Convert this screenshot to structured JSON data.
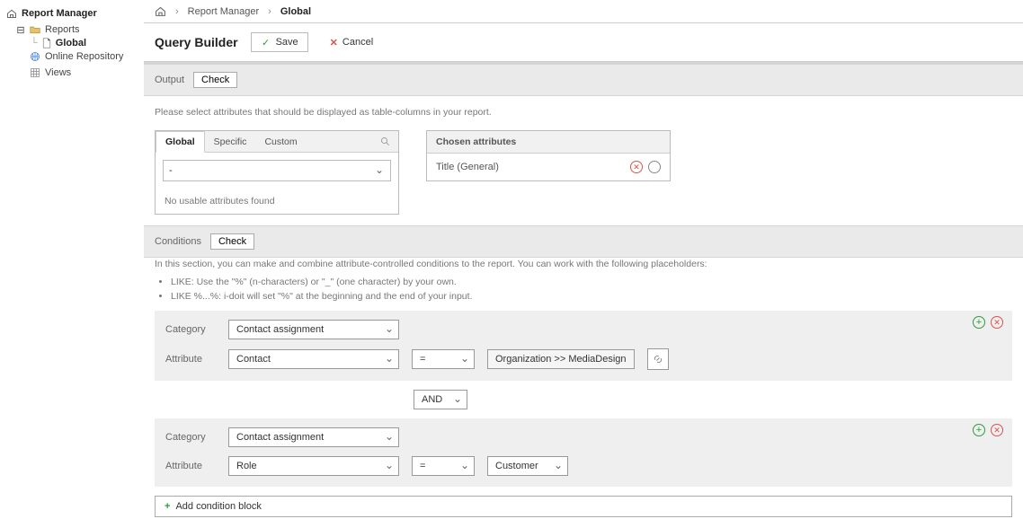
{
  "sidebar": {
    "root": "Report Manager",
    "reports": "Reports",
    "global": "Global",
    "online_repo": "Online Repository",
    "views": "Views"
  },
  "breadcrumb": {
    "item1": "Report Manager",
    "item2": "Global"
  },
  "title": "Query Builder",
  "actions": {
    "save": "Save",
    "cancel": "Cancel"
  },
  "output": {
    "label": "Output",
    "check": "Check",
    "help": "Please select attributes that should be displayed as table-columns in your report.",
    "tabs": {
      "global": "Global",
      "specific": "Specific",
      "custom": "Custom"
    },
    "select_value": "-",
    "no_attr": "No usable attributes found",
    "chosen_header": "Chosen attributes",
    "chosen_item": "Title (General)"
  },
  "conditions": {
    "label": "Conditions",
    "check": "Check",
    "help_intro": "In this section, you can make and combine attribute-controlled conditions to the report. You can work with the following placeholders:",
    "help_li1": "LIKE: Use the \"%\" (n-characters) or \"_\" (one character) by your own.",
    "help_li2": "LIKE %...%: i-doit will set \"%\" at the beginning and the end of your input.",
    "block1": {
      "category_label": "Category",
      "category_value": "Contact assignment",
      "attribute_label": "Attribute",
      "attribute_value": "Contact",
      "operator": "=",
      "value_chip": "Organization >> MediaDesign"
    },
    "logical": "AND",
    "block2": {
      "category_label": "Category",
      "category_value": "Contact assignment",
      "attribute_label": "Attribute",
      "attribute_value": "Role",
      "operator": "=",
      "value": "Customer"
    },
    "add_block": "Add condition block"
  }
}
